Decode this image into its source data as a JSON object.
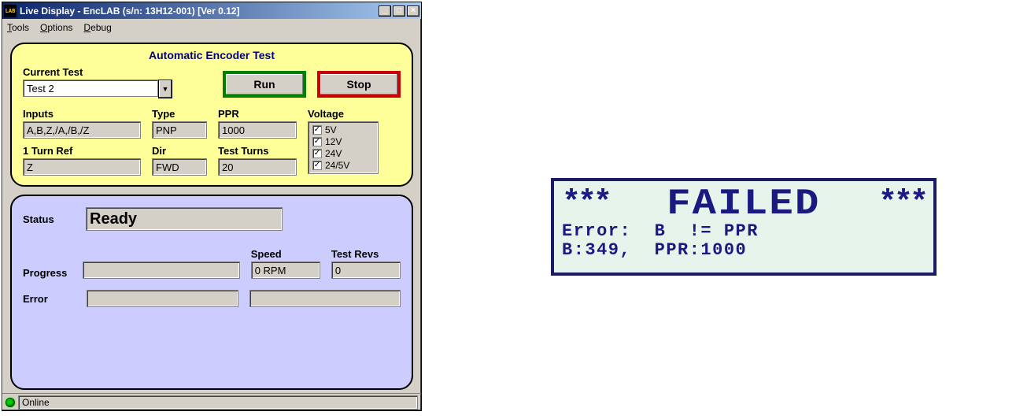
{
  "window": {
    "title": "Live Display - EncLAB (s/n: 13H12-001) [Ver 0.12]",
    "app_icon_text": "LAB"
  },
  "menu": {
    "tools": "Tools",
    "options": "Options",
    "debug": "Debug"
  },
  "test_panel": {
    "title": "Automatic Encoder Test",
    "current_test_label": "Current Test",
    "current_test_value": "Test 2",
    "run_label": "Run",
    "stop_label": "Stop",
    "inputs_label": "Inputs",
    "inputs_value": "A,B,Z,/A,/B,/Z",
    "type_label": "Type",
    "type_value": "PNP",
    "ppr_label": "PPR",
    "ppr_value": "1000",
    "voltage_label": "Voltage",
    "voltage_items": [
      "5V",
      "12V",
      "24V",
      "24/5V"
    ],
    "one_turn_ref_label": "1 Turn Ref",
    "one_turn_ref_value": "Z",
    "dir_label": "Dir",
    "dir_value": "FWD",
    "test_turns_label": "Test Turns",
    "test_turns_value": "20"
  },
  "status_panel": {
    "status_label": "Status",
    "status_value": "Ready",
    "progress_label": "Progress",
    "progress_value": "",
    "speed_label": "Speed",
    "speed_value": "0 RPM",
    "test_revs_label": "Test Revs",
    "test_revs_value": "0",
    "error_label": "Error",
    "error_value_1": "",
    "error_value_2": ""
  },
  "statusbar": {
    "text": "Online"
  },
  "lcd": {
    "stars": "***",
    "failed": "FAILED",
    "line2": "Error:  B  != PPR",
    "line3": "B:349,  PPR:1000"
  }
}
